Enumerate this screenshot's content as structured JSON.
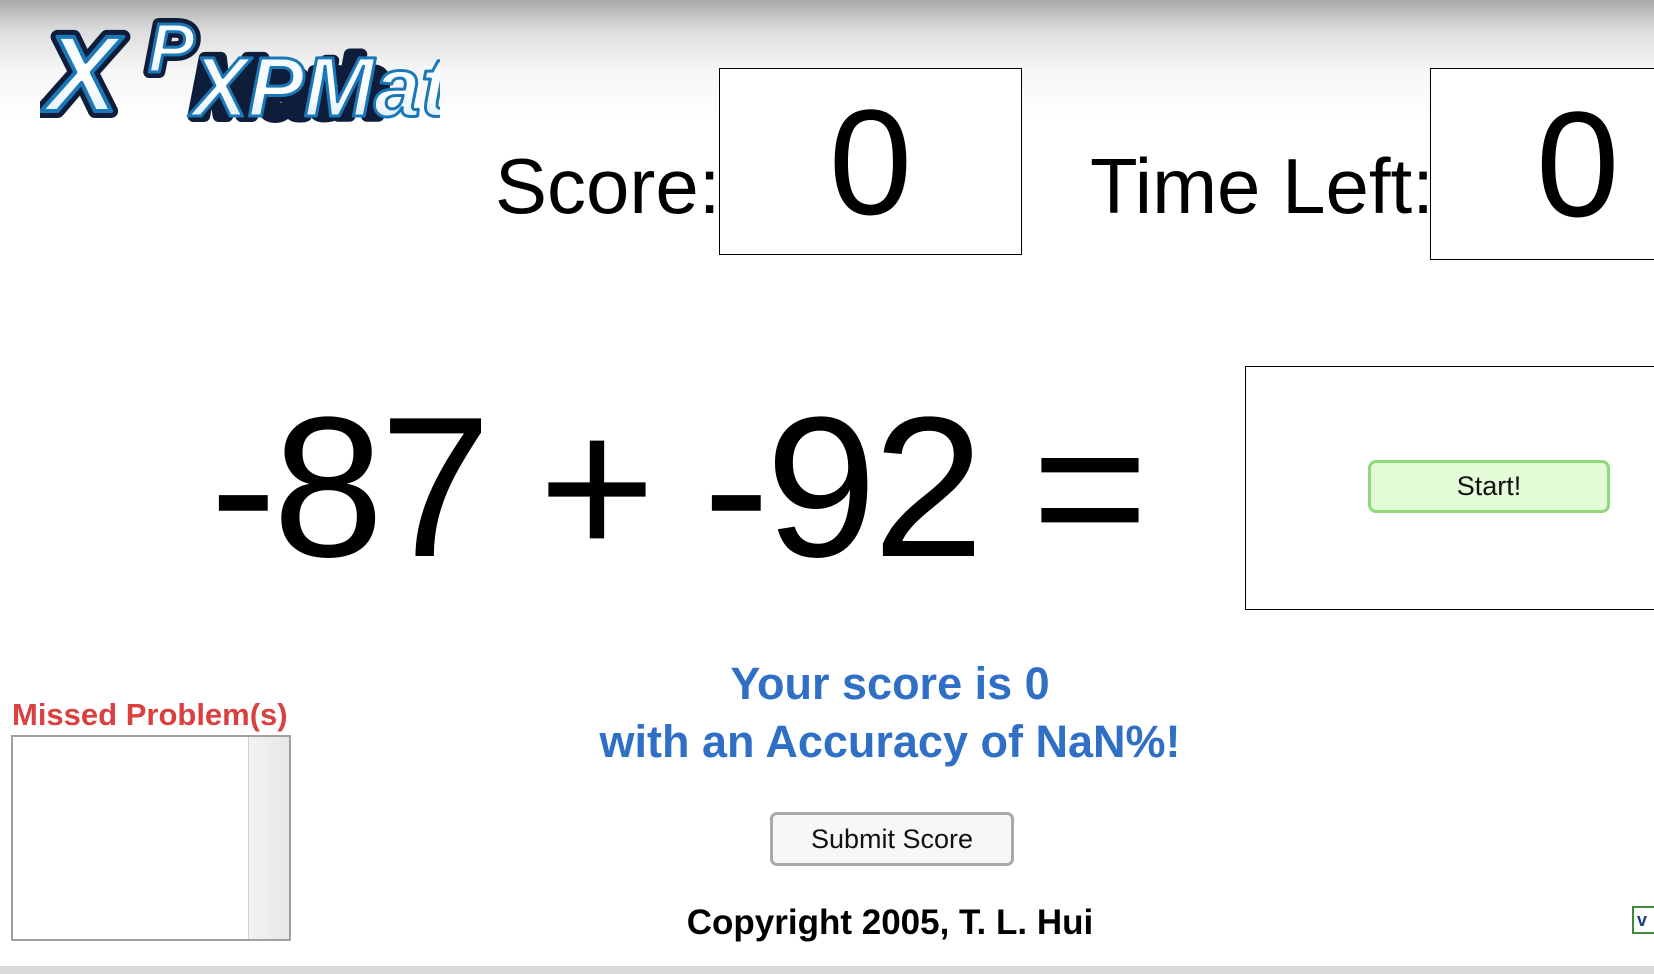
{
  "logo": {
    "text": "XPMath",
    "icon": "xpmath-logo"
  },
  "score": {
    "label": "Score:",
    "value": "0"
  },
  "time": {
    "label": "Time Left:",
    "value": "0"
  },
  "problem": {
    "text": "-87 + -92 ="
  },
  "start_button": {
    "label": "Start!"
  },
  "missed": {
    "title": "Missed Problem(s)",
    "items": []
  },
  "result": {
    "line1": "Your score is 0",
    "line2": "with an Accuracy of NaN%!"
  },
  "submit_button": {
    "label": "Submit Score"
  },
  "copyright": "Copyright 2005, T. L. Hui",
  "corner": {
    "icon": "checkbox-icon",
    "text": "v"
  },
  "colors": {
    "missed_title": "#d94040",
    "result_text": "#2f6fc6",
    "start_bg": "#e4fbd8",
    "start_border": "#8fd97a"
  }
}
